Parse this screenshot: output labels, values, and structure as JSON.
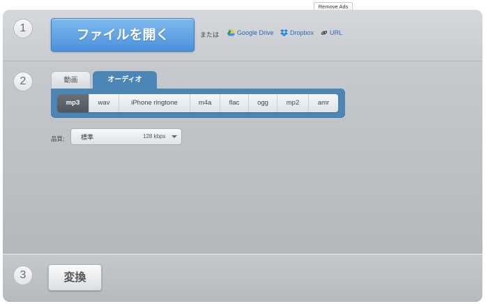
{
  "remove_ads": "Remove Ads",
  "step1": {
    "number": "1",
    "open_button": "ファイルを開く",
    "or_text": "または",
    "sources": [
      {
        "label": "Google Drive",
        "icon": "google-drive-icon"
      },
      {
        "label": "Dropbox",
        "icon": "dropbox-icon"
      },
      {
        "label": "URL",
        "icon": "link-icon"
      }
    ]
  },
  "step2": {
    "number": "2",
    "tabs": [
      {
        "label": "動画",
        "active": false
      },
      {
        "label": "オーディオ",
        "active": true
      }
    ],
    "formats": [
      "mp3",
      "wav",
      "iPhone ringtone",
      "m4a",
      "flac",
      "ogg",
      "mp2",
      "amr"
    ],
    "selected_format": "mp3",
    "quality": {
      "label": "品質:",
      "value": "標準",
      "bitrate": "128 kbps"
    }
  },
  "step3": {
    "number": "3",
    "convert_button": "変換"
  },
  "colors": {
    "accent_blue": "#4a91dc",
    "tab_bar_blue": "#4c86b7",
    "link_blue": "#2b67b5"
  }
}
